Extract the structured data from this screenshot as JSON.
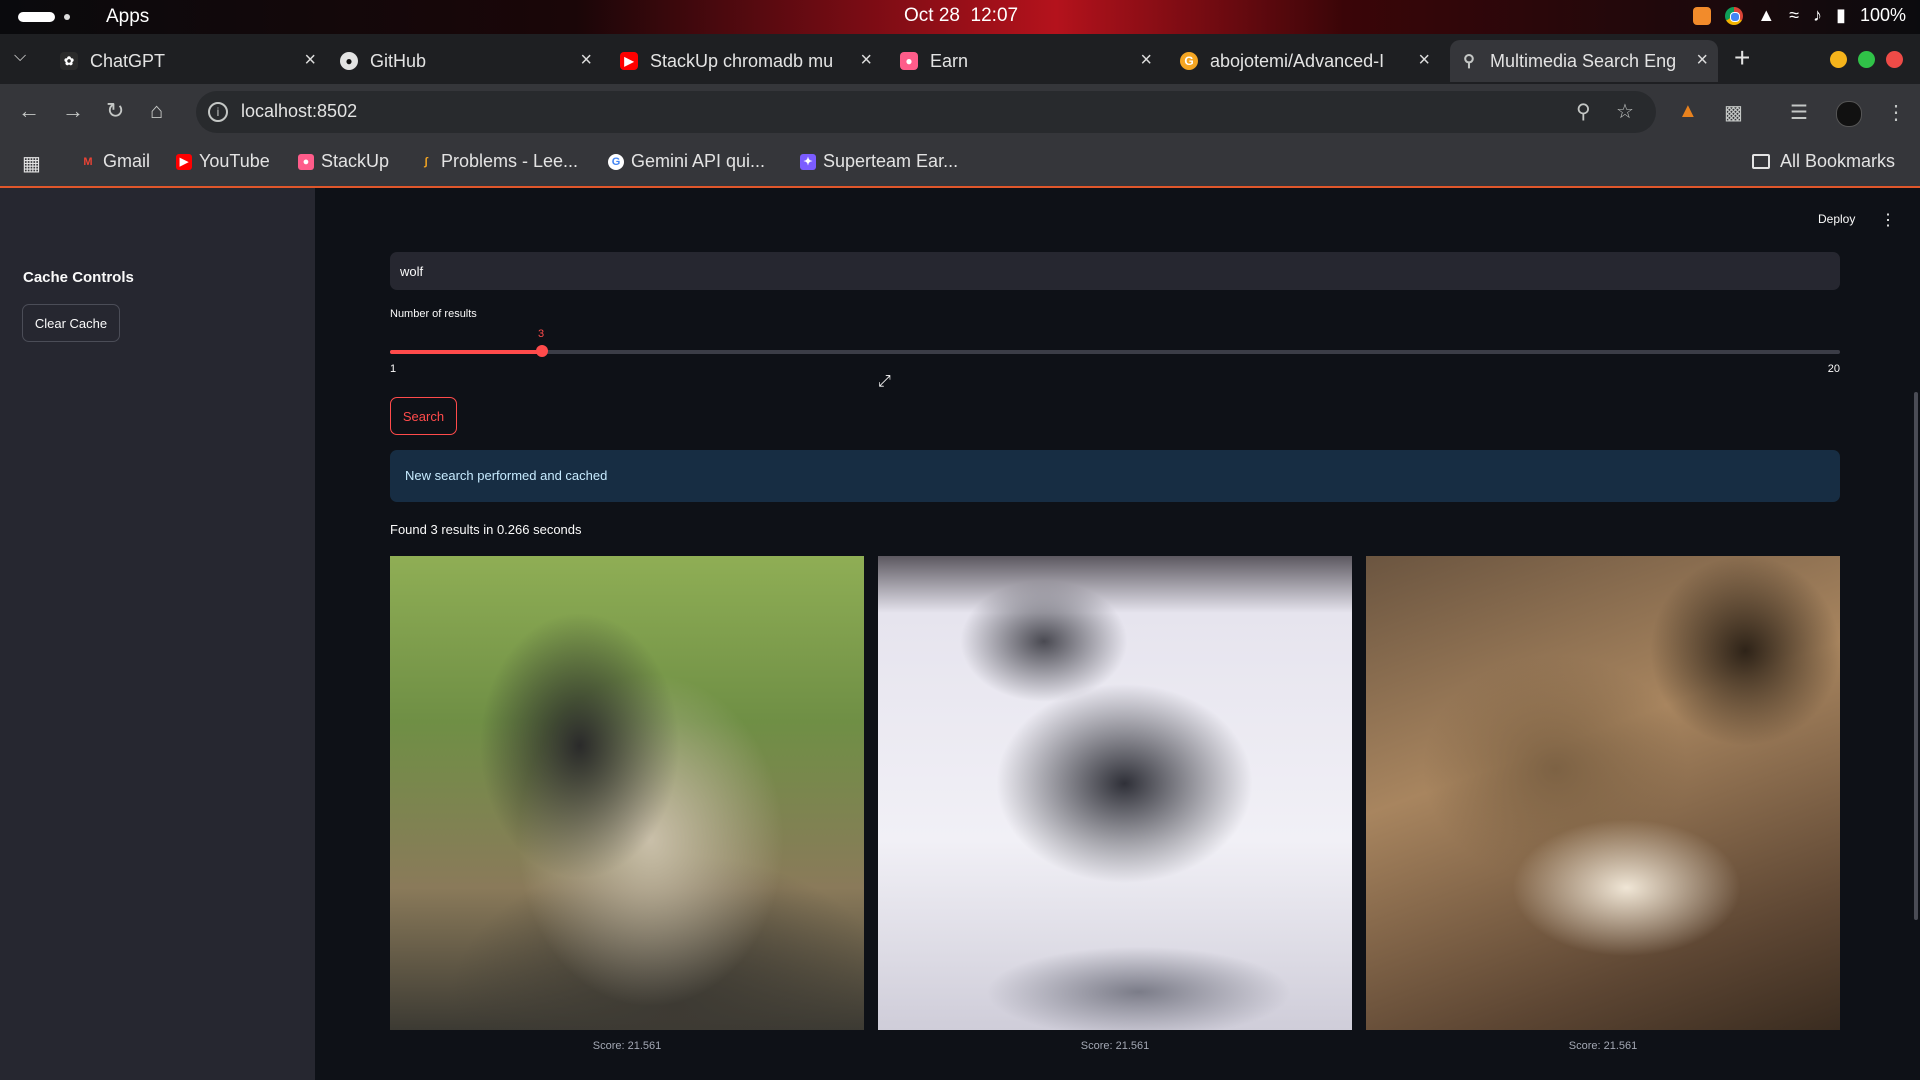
{
  "os": {
    "apps_label": "Apps",
    "date": "Oct 28",
    "time": "12:07",
    "battery": "100%"
  },
  "tabs": [
    {
      "title": "ChatGPT",
      "favicon": "chatgpt-icon"
    },
    {
      "title": "GitHub",
      "favicon": "github-icon"
    },
    {
      "title": "StackUp chromadb mu",
      "favicon": "youtube-icon"
    },
    {
      "title": "Earn",
      "favicon": "stackup-icon"
    },
    {
      "title": "abojotemi/Advanced-I",
      "favicon": "git-icon"
    },
    {
      "title": "Multimedia Search Eng",
      "favicon": "search-icon",
      "active": true
    }
  ],
  "address": {
    "url": "localhost:8502"
  },
  "bookmarks": [
    {
      "label": "Gmail",
      "color": "#ea4335"
    },
    {
      "label": "YouTube",
      "color": "#ff0000"
    },
    {
      "label": "StackUp",
      "color": "#ff5c8a"
    },
    {
      "label": "Problems - Lee...",
      "color": "#f5a623"
    },
    {
      "label": "Gemini API qui...",
      "color": "#4285f4"
    },
    {
      "label": "Superteam Ear...",
      "color": "#7b5cff"
    }
  ],
  "all_bookmarks": "All Bookmarks",
  "header": {
    "deploy": "Deploy"
  },
  "sidebar": {
    "heading": "Cache Controls",
    "clear_cache": "Clear Cache"
  },
  "search": {
    "query": "wolf",
    "slider_label": "Number of results",
    "slider_value": "3",
    "slider_min": "1",
    "slider_max": "20",
    "slider_fraction": 0.105,
    "button": "Search",
    "alert": "New search performed and cached",
    "found": "Found 3 results in 0.266 seconds"
  },
  "results": [
    {
      "score": "Score: 21.561",
      "subject": "howling wolf"
    },
    {
      "score": "Score: 21.561",
      "subject": "wolf in snow"
    },
    {
      "score": "Score: 21.561",
      "subject": "wolf face closeup"
    }
  ],
  "colors": {
    "accent": "#ff4b4b",
    "app_bg": "#0e1117",
    "sidebar_bg": "#262730",
    "alert_bg": "#172d43"
  }
}
